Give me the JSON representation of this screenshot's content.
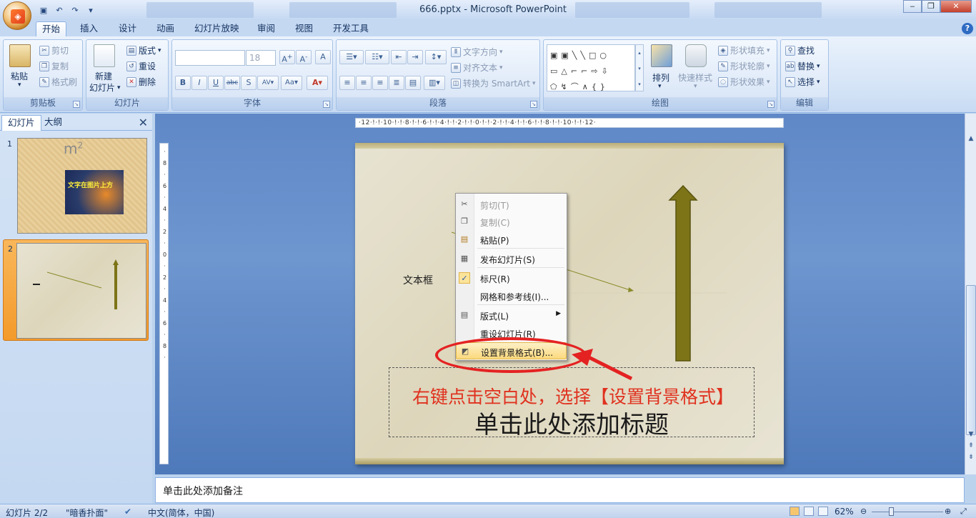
{
  "window": {
    "title": "666.pptx - Microsoft PowerPoint"
  },
  "tabs": [
    "开始",
    "插入",
    "设计",
    "动画",
    "幻灯片放映",
    "审阅",
    "视图",
    "开发工具"
  ],
  "ribbon": {
    "clipboard": {
      "paste": "粘贴",
      "cut": "剪切",
      "copy": "复制",
      "format_painter": "格式刷",
      "label": "剪贴板"
    },
    "slides": {
      "new_slide_line1": "新建",
      "new_slide_line2": "幻灯片",
      "layout": "版式",
      "reset": "重设",
      "delete": "删除",
      "label": "幻灯片"
    },
    "font": {
      "size": "18",
      "label": "字体"
    },
    "paragraph": {
      "text_direction": "文字方向",
      "align_text": "对齐文本",
      "convert_smartart": "转换为 SmartArt",
      "label": "段落"
    },
    "drawing": {
      "arrange": "排列",
      "quick_styles": "快速样式",
      "shape_fill": "形状填充",
      "shape_outline": "形状轮廓",
      "shape_effects": "形状效果",
      "label": "绘图"
    },
    "editing": {
      "find": "查找",
      "replace": "替换",
      "select": "选择",
      "label": "编辑"
    }
  },
  "panel": {
    "tab_slides": "幻灯片",
    "tab_outline": "大纲",
    "slide1": {
      "num": "1",
      "superscript": "m",
      "sup": "2",
      "caption": "文字在图片上方"
    },
    "slide2": {
      "num": "2"
    }
  },
  "slide": {
    "textbox_label": "文本框",
    "title_placeholder": "单击此处添加标题",
    "instruction": "右键点击空白处，选择【设置背景格式】"
  },
  "context_menu": [
    {
      "label": "剪切(T)",
      "disabled": true,
      "icon": "scissors-icon"
    },
    {
      "label": "复制(C)",
      "disabled": true,
      "icon": "copy-icon"
    },
    {
      "label": "粘贴(P)",
      "disabled": false,
      "icon": "paste-icon"
    },
    {
      "label": "发布幻灯片(S)",
      "disabled": false,
      "icon": "publish-icon"
    },
    {
      "label": "标尺(R)",
      "disabled": false,
      "icon": "checkmark-icon",
      "checked": true
    },
    {
      "label": "网格和参考线(I)...",
      "disabled": false
    },
    {
      "label": "版式(L)",
      "disabled": false,
      "icon": "layout-icon",
      "submenu": true
    },
    {
      "label": "重设幻灯片(R)",
      "disabled": false
    },
    {
      "label": "设置背景格式(B)...",
      "disabled": false,
      "icon": "background-icon",
      "highlighted": true
    }
  ],
  "notes": {
    "placeholder": "单击此处添加备注"
  },
  "status": {
    "slide_info": "幻灯片 2/2",
    "theme": "\"暗香扑面\"",
    "language": "中文(简体，中国)",
    "zoom": "62%"
  },
  "colors": {
    "accent_red": "#e42222",
    "arrow_olive": "#7d7418"
  }
}
